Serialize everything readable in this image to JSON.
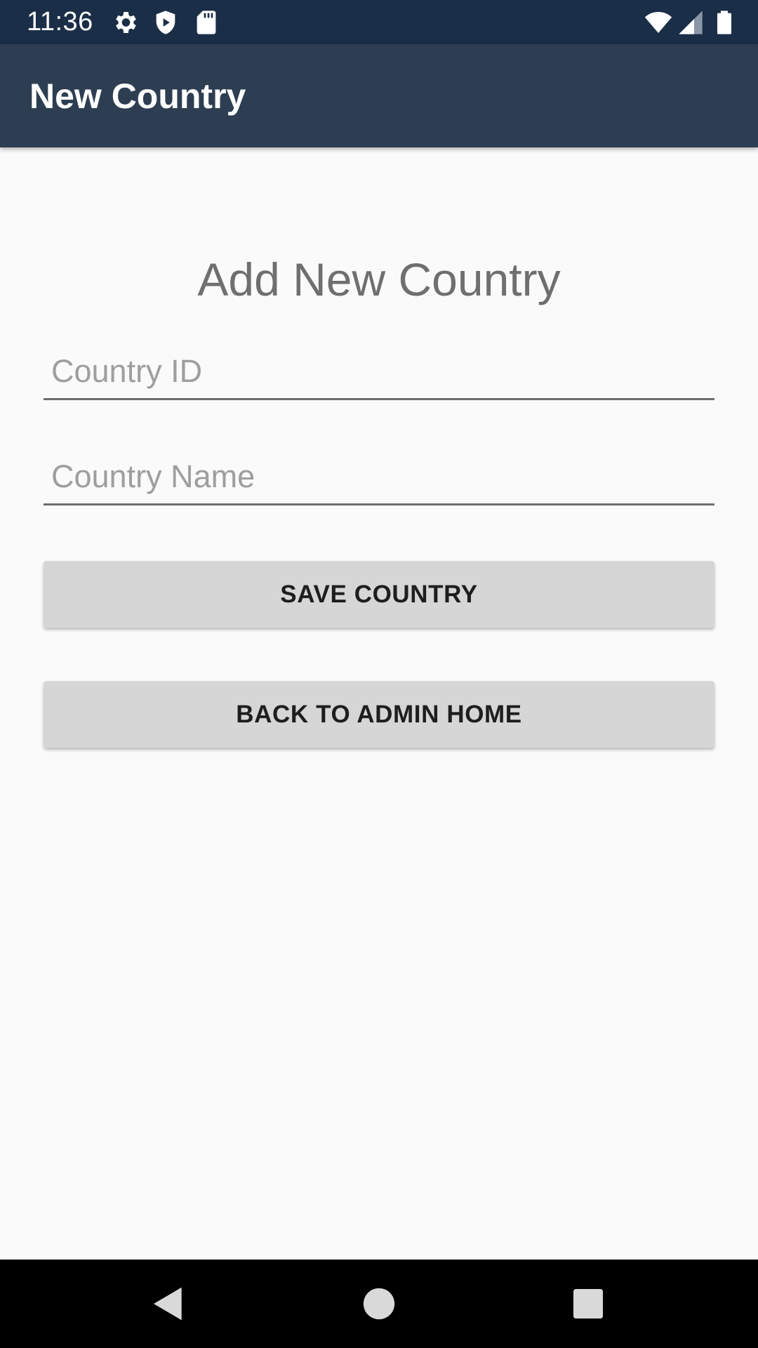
{
  "status_bar": {
    "time": "11:36",
    "icons": [
      "gear-icon",
      "shield-icon",
      "sd-card-icon",
      "wifi-icon",
      "signal-icon",
      "battery-icon"
    ]
  },
  "app_bar": {
    "title": "New Country"
  },
  "form": {
    "heading": "Add New Country",
    "country_id": {
      "value": "",
      "placeholder": "Country ID"
    },
    "country_name": {
      "value": "",
      "placeholder": "Country Name"
    },
    "save_label": "SAVE COUNTRY",
    "back_label": "BACK TO ADMIN HOME"
  },
  "nav_bar": {
    "buttons": [
      "back-icon",
      "home-icon",
      "recents-icon"
    ]
  },
  "colors": {
    "status_bar": "#1b2e47",
    "app_bar": "#2e3e52",
    "background": "#fafafa",
    "button": "#d6d6d6"
  }
}
